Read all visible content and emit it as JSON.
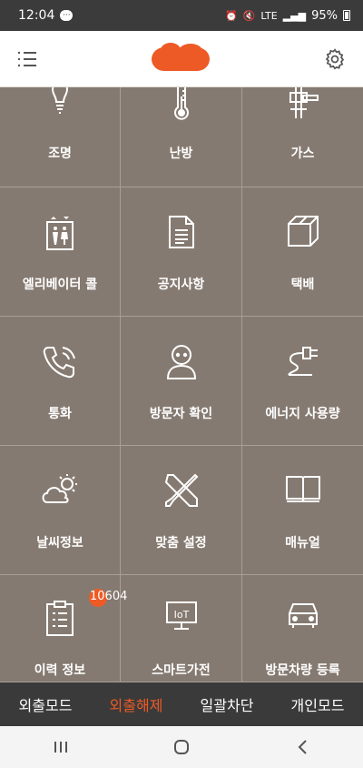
{
  "status": {
    "time": "12:04",
    "battery": "95%",
    "network": "LTE"
  },
  "header": {
    "menu_icon": "list-icon",
    "settings_icon": "gear-icon",
    "logo": "logo-blob",
    "accent": "#ee5a26"
  },
  "tiles": [
    {
      "label": "조명",
      "icon": "lightbulb-icon"
    },
    {
      "label": "난방",
      "icon": "thermometer-icon"
    },
    {
      "label": "가스",
      "icon": "gas-valve-icon"
    },
    {
      "label": "엘리베이터 콜",
      "icon": "elevator-icon"
    },
    {
      "label": "공지사항",
      "icon": "document-icon"
    },
    {
      "label": "택배",
      "icon": "package-icon"
    },
    {
      "label": "통화",
      "icon": "phone-icon"
    },
    {
      "label": "방문자 확인",
      "icon": "visitor-icon"
    },
    {
      "label": "에너지 사용량",
      "icon": "energy-plug-icon"
    },
    {
      "label": "날씨정보",
      "icon": "weather-icon"
    },
    {
      "label": "맞춤 설정",
      "icon": "tools-icon"
    },
    {
      "label": "매뉴얼",
      "icon": "book-icon"
    },
    {
      "label": "이력 정보",
      "icon": "clipboard-icon",
      "badge": "10604"
    },
    {
      "label": "스마트가전",
      "icon": "iot-monitor-icon"
    },
    {
      "label": "방문차량 등록",
      "icon": "car-icon"
    }
  ],
  "modes": [
    {
      "label": "외출모드",
      "active": false
    },
    {
      "label": "외출해제",
      "active": true
    },
    {
      "label": "일괄차단",
      "active": false
    },
    {
      "label": "개인모드",
      "active": false
    }
  ],
  "colors": {
    "grid_bg": "#857a71",
    "mode_bar_bg": "#3a3a3a",
    "active_mode": "#ee5a26"
  }
}
